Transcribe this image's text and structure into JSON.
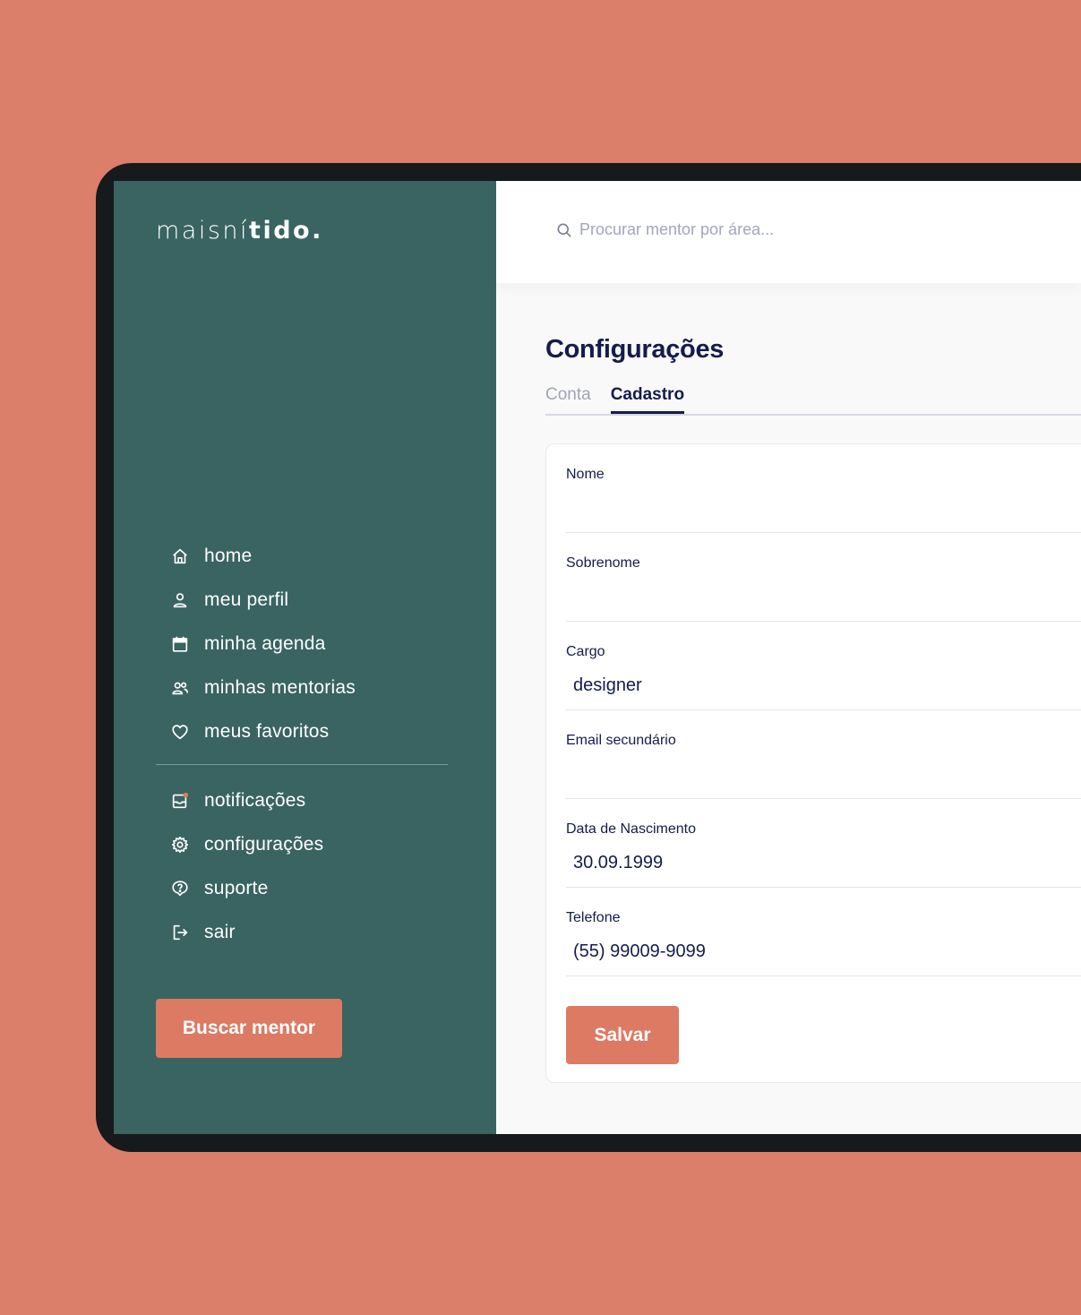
{
  "colors": {
    "background": "#db7f6b",
    "sidebar": "#396461",
    "accent": "#dc7a64",
    "title": "#141c4c"
  },
  "logo": {
    "part1": "maisní",
    "part2": "tido."
  },
  "nav_primary": [
    {
      "label": "home",
      "icon": "home-icon"
    },
    {
      "label": "meu perfil",
      "icon": "user-icon"
    },
    {
      "label": "minha agenda",
      "icon": "calendar-icon"
    },
    {
      "label": "minhas mentorias",
      "icon": "users-icon"
    },
    {
      "label": "meus favoritos",
      "icon": "heart-icon"
    }
  ],
  "nav_secondary": [
    {
      "label": "notificações",
      "icon": "inbox-notification-icon"
    },
    {
      "label": "configurações",
      "icon": "gear-icon"
    },
    {
      "label": "suporte",
      "icon": "help-icon"
    },
    {
      "label": "sair",
      "icon": "logout-icon"
    }
  ],
  "cta": {
    "label": "Buscar mentor"
  },
  "search": {
    "placeholder": "Procurar mentor por área..."
  },
  "page": {
    "title": "Configurações"
  },
  "tabs": [
    {
      "label": "Conta",
      "active": false
    },
    {
      "label": "Cadastro",
      "active": true
    }
  ],
  "form": {
    "fields": [
      {
        "label": "Nome",
        "value": ""
      },
      {
        "label": "Sobrenome",
        "value": ""
      },
      {
        "label": "Cargo",
        "value": "designer"
      },
      {
        "label": "Email secundário",
        "value": ""
      },
      {
        "label": "Data de Nascimento",
        "value": "30.09.1999"
      },
      {
        "label": "Telefone",
        "value": "(55) 99009-9099"
      }
    ],
    "save_label": "Salvar"
  }
}
